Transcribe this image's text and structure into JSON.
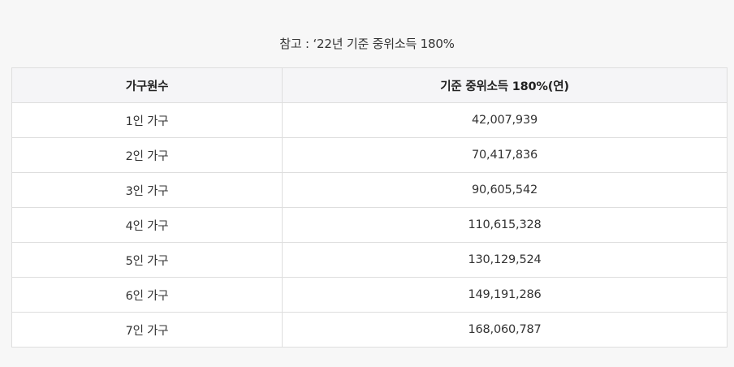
{
  "caption": "참고 : ‘22년 기준 중위소득 180%",
  "table": {
    "headers": [
      "가구원수",
      "기준 중위소득 180%(연)"
    ],
    "rows": [
      [
        "1인 가구",
        "42,007,939"
      ],
      [
        "2인 가구",
        "70,417,836"
      ],
      [
        "3인 가구",
        "90,605,542"
      ],
      [
        "4인 가구",
        "110,615,328"
      ],
      [
        "5인 가구",
        "130,129,524"
      ],
      [
        "6인 가구",
        "149,191,286"
      ],
      [
        "7인 가구",
        "168,060,787"
      ]
    ]
  }
}
